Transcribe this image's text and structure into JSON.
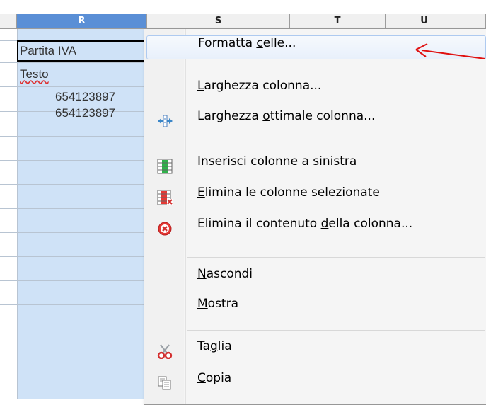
{
  "spreadsheet": {
    "column_headers": [
      "R",
      "S",
      "T",
      "U"
    ],
    "selected_column": "R",
    "cells": {
      "r1": "Partita IVA",
      "r2": "Testo",
      "r3": "654123897",
      "r4": "654123897"
    }
  },
  "context_menu": {
    "items": [
      {
        "label": "Formatta celle...",
        "accesskey": "c",
        "icon": ""
      },
      {
        "label": "Larghezza colonna...",
        "accesskey": "L",
        "icon": ""
      },
      {
        "label": "Larghezza ottimale colonna...",
        "accesskey": "o",
        "icon": "column-width-arrows-icon"
      },
      {
        "label": "Inserisci colonne a sinistra",
        "accesskey": "a",
        "icon": "insert-column-icon"
      },
      {
        "label": "Elimina le colonne selezionate",
        "accesskey": "E",
        "icon": "delete-column-icon"
      },
      {
        "label": "Elimina il contenuto della colonna...",
        "accesskey": "d",
        "icon": "delete-content-icon"
      },
      {
        "label": "Nascondi",
        "accesskey": "N",
        "icon": ""
      },
      {
        "label": "Mostra",
        "accesskey": "M",
        "icon": ""
      },
      {
        "label": "Taglia",
        "accesskey": "g",
        "icon": "scissors-icon"
      },
      {
        "label": "Copia",
        "accesskey": "C",
        "icon": "copy-icon"
      }
    ]
  },
  "annotation": {
    "arrow_color": "#e01010"
  },
  "colors": {
    "selection": "#cfe2f7",
    "header_selected": "#5a8fd6",
    "hover_border": "#aecaf0"
  }
}
